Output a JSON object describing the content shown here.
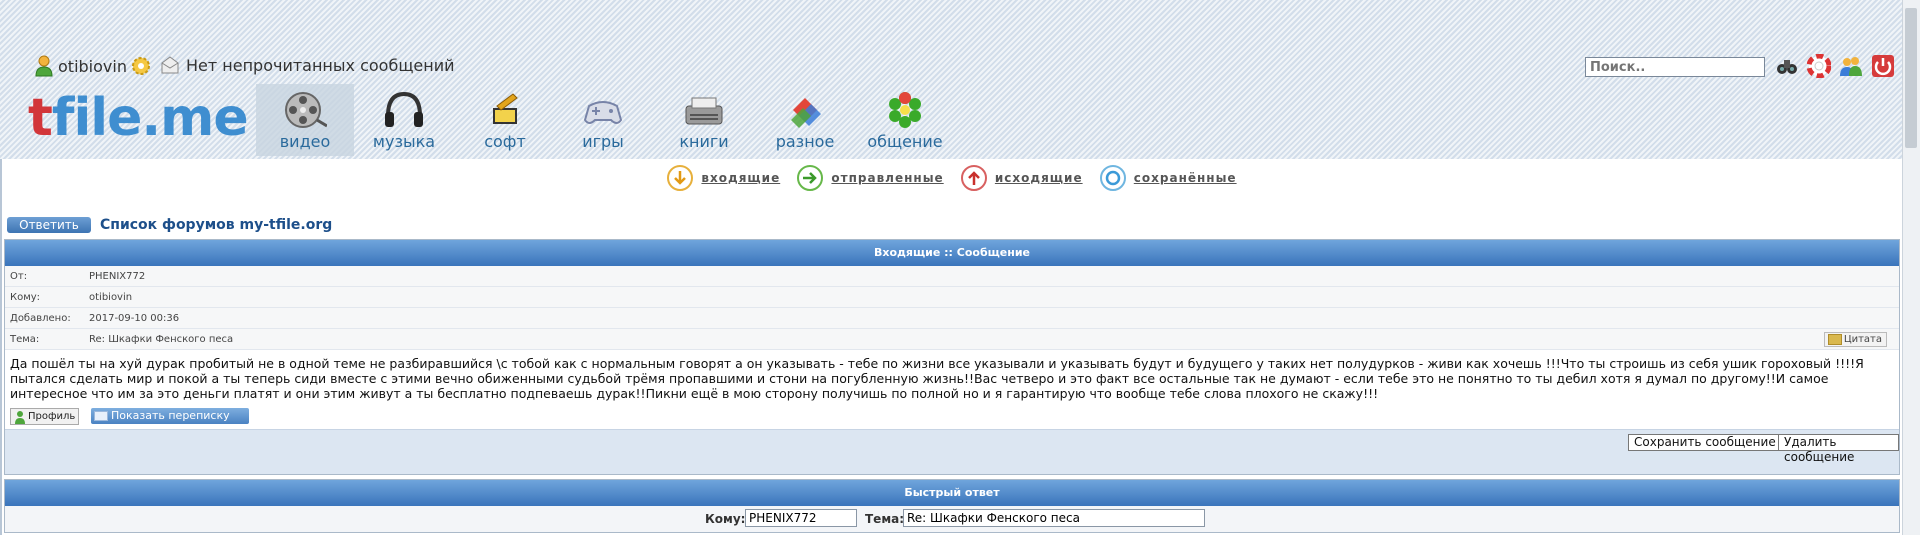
{
  "topbar": {
    "username": "otibiovin",
    "messages_status": "Нет непрочитанных сообщений",
    "search_placeholder": "Поиск.."
  },
  "nav": {
    "logo_t": "t",
    "logo_rest": "file.me",
    "categories": [
      {
        "label": "видео",
        "icon": "film-reel-icon"
      },
      {
        "label": "музыка",
        "icon": "headphones-icon"
      },
      {
        "label": "софт",
        "icon": "software-icon"
      },
      {
        "label": "игры",
        "icon": "gamepad-icon"
      },
      {
        "label": "книги",
        "icon": "typewriter-icon"
      },
      {
        "label": "разное",
        "icon": "misc-icon"
      },
      {
        "label": "общение",
        "icon": "icq-flower-icon"
      }
    ]
  },
  "folders": {
    "inbox": "входящие",
    "sent": "отправленные",
    "outbox": "исходящие",
    "saved": "сохранённые"
  },
  "actions": {
    "reply": "Ответить",
    "forum_link": "Список форумов my-tfile.org"
  },
  "message": {
    "header": "Входящие :: Сообщение",
    "from_label": "От:",
    "from": "PHENIX772",
    "to_label": "Кому:",
    "to": "otibiovin",
    "date_label": "Добавлено:",
    "date": "2017-09-10 00:36",
    "subject_label": "Тема:",
    "subject": "Re: Шкафки Фенского песа",
    "quote_button": "Цитата",
    "body": "Да пошёл ты на хуй дурак пробитый не в одной теме не разбиравшийся \\с тобой как с нормальным говорят а он указывать - тебе по жизни все указывали и указывать будут и будущего у таких нет полудурков - живи как хочешь !!!Что ты строишь из себя ушик гороховый !!!!Я пытался сделать мир и покой а ты теперь сиди вместе с этими вечно обиженными судьбой трёмя пропавшими и стони на погубленную жизнь!!Вас четверо и это факт все остальные так не думают - если тебе это не понятно то ты дебил хотя я думал по другому!!И самое интересное что им за это деньги платят и они этим живут а ты бесплатно подпеваешь дурак!!Пикни ещё в мою сторону получишь по полной но и я гарантирую что вообще тебе слова плохого не скажу!!!",
    "profile_button": "Профиль",
    "show_thread_button": "Показать переписку",
    "save_button": "Сохранить сообщение",
    "delete_button": "Удалить сообщение"
  },
  "quick_reply": {
    "header": "Быстрый ответ",
    "to_label": "Кому:",
    "to_value": "PHENIX772",
    "subject_label": "Тема:",
    "subject_value": "Re: Шкафки Фенского песа"
  }
}
